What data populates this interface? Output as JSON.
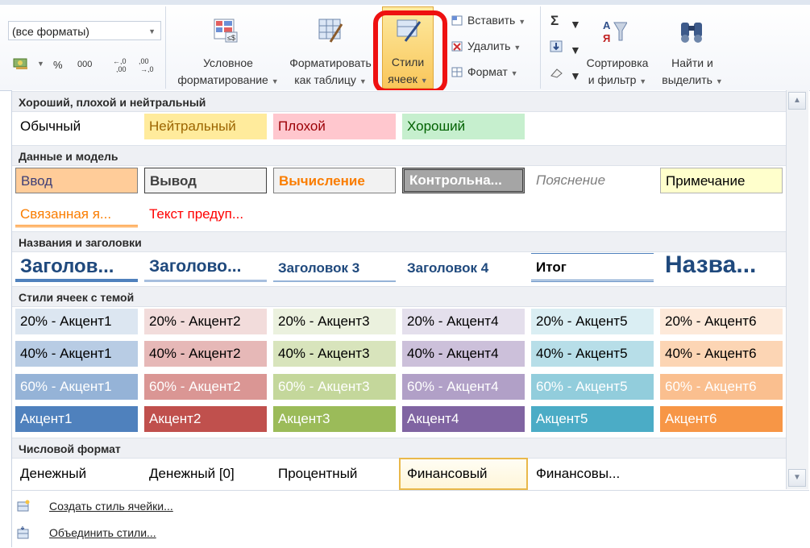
{
  "ribbon": {
    "number_format": "(все форматы)",
    "number_buttons": [
      "%",
      "000"
    ],
    "conditional_formatting": [
      "Условное",
      "форматирование"
    ],
    "format_as_table": [
      "Форматировать",
      "как таблицу"
    ],
    "cell_styles": [
      "Стили",
      "ячеек"
    ],
    "insert": "Вставить",
    "delete": "Удалить",
    "format": "Формат",
    "sum_symbol": "Σ",
    "sort_filter": [
      "Сортировка",
      "и фильтр"
    ],
    "find_select": [
      "Найти и",
      "выделить"
    ]
  },
  "gallery": {
    "sections": [
      "Хороший, плохой и нейтральный",
      "Данные и модель",
      "Названия и заголовки",
      "Стили ячеек с темой",
      "Числовой формат"
    ],
    "good_bad": [
      "Обычный",
      "Нейтральный",
      "Плохой",
      "Хороший"
    ],
    "data_model_row1": [
      "Ввод",
      "Вывод",
      "Вычисление",
      "Контрольна...",
      "Пояснение",
      "Примечание"
    ],
    "data_model_row2": [
      "Связанная я...",
      "Текст предуп..."
    ],
    "titles": [
      "Заголов...",
      "Заголово...",
      "Заголовок 3",
      "Заголовок 4",
      "Итог",
      "Назва..."
    ],
    "theme_rows": [
      [
        "20% - Акцент1",
        "20% - Акцент2",
        "20% - Акцент3",
        "20% - Акцент4",
        "20% - Акцент5",
        "20% - Акцент6"
      ],
      [
        "40% - Акцент1",
        "40% - Акцент2",
        "40% - Акцент3",
        "40% - Акцент4",
        "40% - Акцент5",
        "40% - Акцент6"
      ],
      [
        "60% - Акцент1",
        "60% - Акцент2",
        "60% - Акцент3",
        "60% - Акцент4",
        "60% - Акцент5",
        "60% - Акцент6"
      ],
      [
        "Акцент1",
        "Акцент2",
        "Акцент3",
        "Акцент4",
        "Акцент5",
        "Акцент6"
      ]
    ],
    "number_format": [
      "Денежный",
      "Денежный [0]",
      "Процентный",
      "Финансовый",
      "Финансовы..."
    ]
  },
  "menu": {
    "new_style": "Создать стиль ячейки...",
    "merge_styles": "Объединить стили..."
  },
  "colors": {
    "highlight": "#ee1111",
    "accent1": "#4f81bd",
    "accent2": "#c0504d",
    "accent3": "#9bbb59",
    "accent4": "#8064a2",
    "accent5": "#4bacc6",
    "accent6": "#f79646"
  }
}
